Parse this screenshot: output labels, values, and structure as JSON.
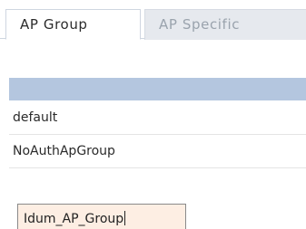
{
  "tabs": [
    {
      "label": "AP Group",
      "active": true
    },
    {
      "label": "AP Specific",
      "active": false
    }
  ],
  "list": {
    "rows": [
      {
        "name": "default"
      },
      {
        "name": "NoAuthApGroup"
      }
    ]
  },
  "new_group_input": {
    "value": "Idum_AP_Group"
  },
  "colors": {
    "header_bar": "#b4c6df",
    "input_background": "#fdeee3",
    "inactive_tab": "#e6e9ee"
  }
}
